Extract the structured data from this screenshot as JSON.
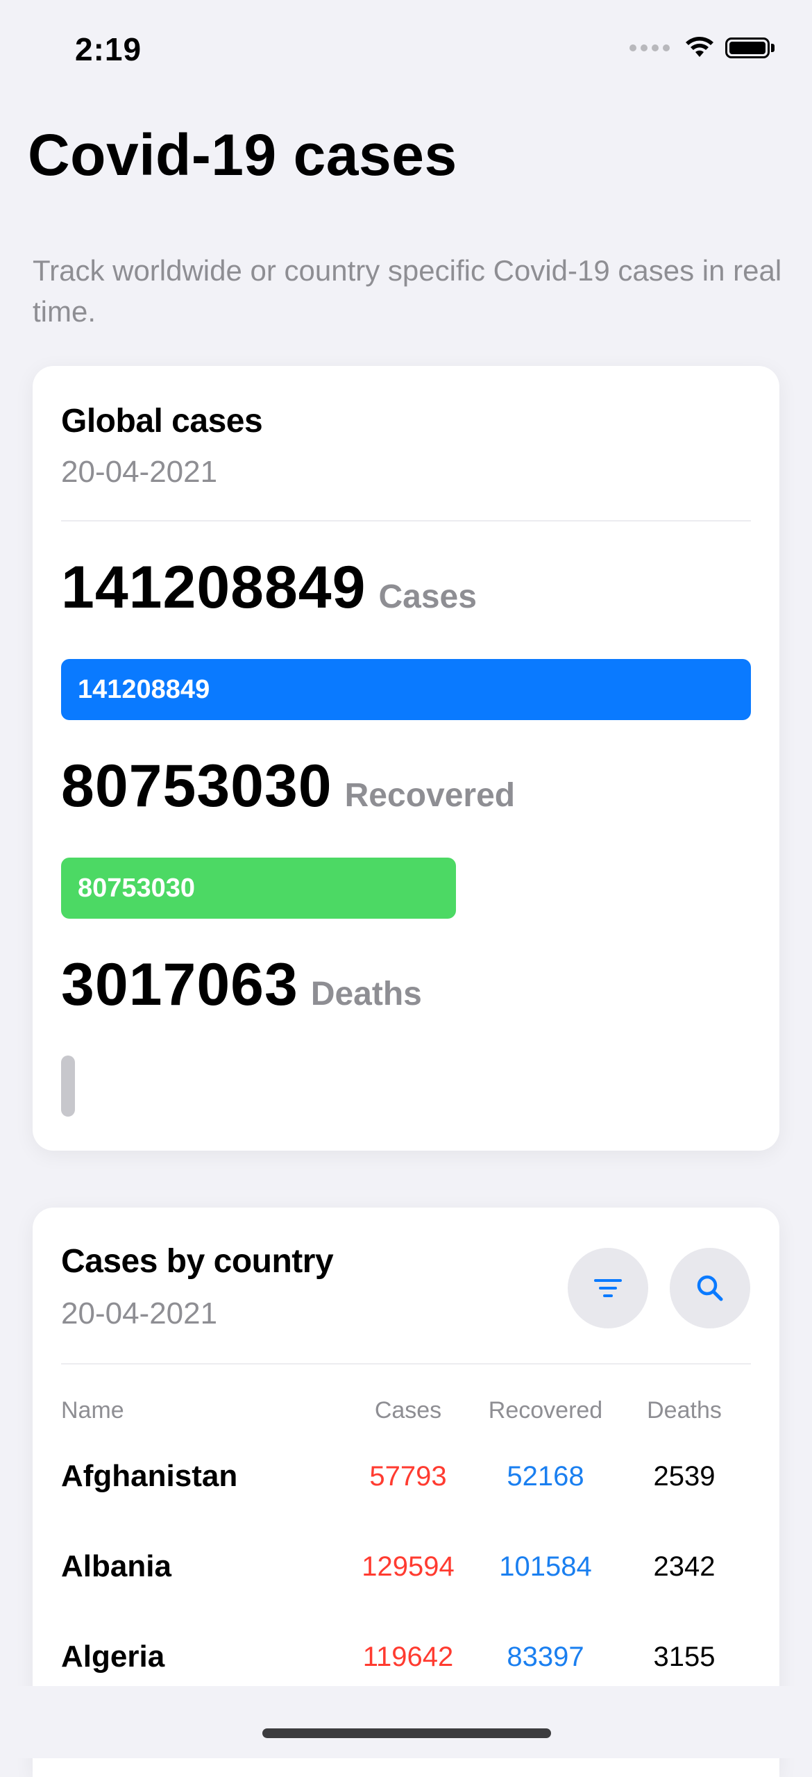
{
  "status_bar": {
    "time": "2:19"
  },
  "header": {
    "title": "Covid-19 cases",
    "subtitle": "Track worldwide or country specific Covid-19 cases in real time."
  },
  "global": {
    "title": "Global cases",
    "date": "20-04-2021",
    "stats": [
      {
        "value": "141208849",
        "label": "Cases",
        "bar_text": "141208849",
        "bar_fraction": 1.0,
        "color": "#0a7aff"
      },
      {
        "value": "80753030",
        "label": "Recovered",
        "bar_text": "80753030",
        "bar_fraction": 0.572,
        "color": "#4cd964"
      },
      {
        "value": "3017063",
        "label": "Deaths",
        "bar_text": "",
        "bar_fraction": 0.021,
        "color": "#c7c7cc"
      }
    ]
  },
  "countries": {
    "title": "Cases by country",
    "date": "20-04-2021",
    "filter_icon": "filter-icon",
    "search_icon": "search-icon",
    "columns": [
      "Name",
      "Cases",
      "Recovered",
      "Deaths"
    ],
    "rows": [
      {
        "name": "Afghanistan",
        "cases": "57793",
        "recovered": "52168",
        "deaths": "2539"
      },
      {
        "name": "Albania",
        "cases": "129594",
        "recovered": "101584",
        "deaths": "2342"
      },
      {
        "name": "Algeria",
        "cases": "119642",
        "recovered": "83397",
        "deaths": "3155"
      }
    ]
  },
  "colors": {
    "accent": "#0a7aff",
    "recovered": "#4cd964",
    "cases_text": "#ff3b30",
    "recovered_text": "#1a7ff0",
    "background": "#f2f2f7"
  }
}
